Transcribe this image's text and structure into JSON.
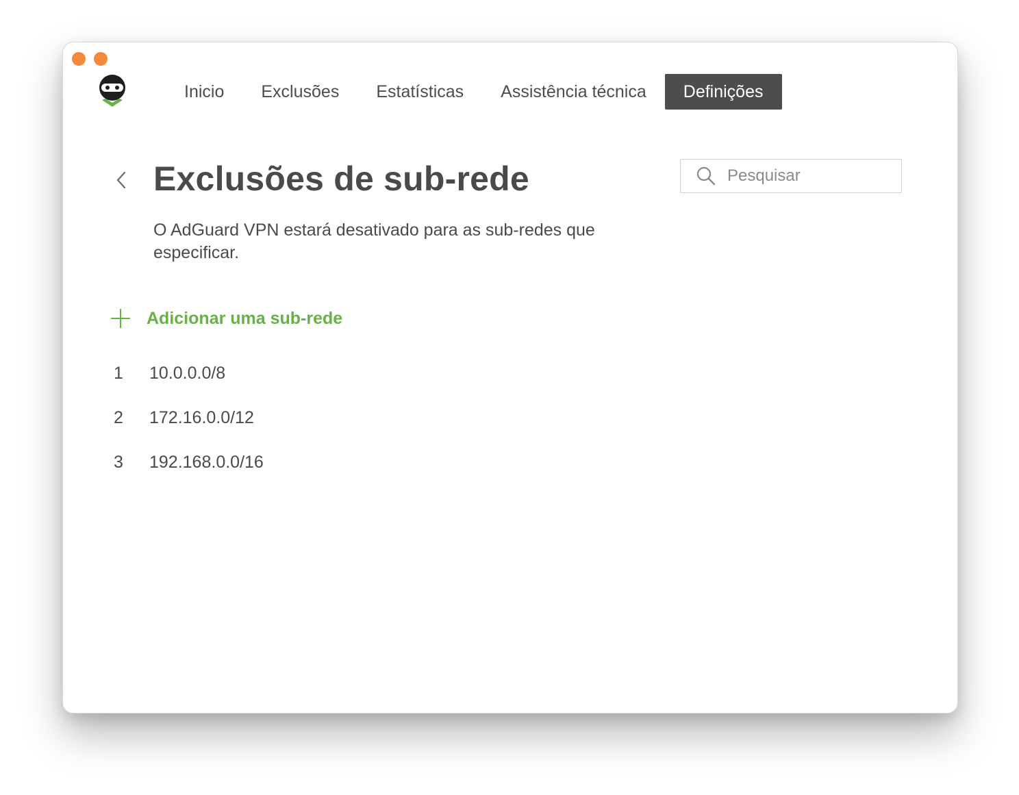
{
  "window": {
    "traffic_lights": [
      "close",
      "minimize"
    ],
    "traffic_color": "#f5893a"
  },
  "logo": {
    "icon": "adguard-ninja-icon",
    "accent": "#67b246"
  },
  "nav": {
    "items": [
      {
        "label": "Inicio"
      },
      {
        "label": "Exclusões"
      },
      {
        "label": "Estatísticas"
      },
      {
        "label": "Assistência técnica"
      },
      {
        "label": "Definições",
        "active": true
      }
    ]
  },
  "page": {
    "title": "Exclusões de sub-rede",
    "description": "O AdGuard VPN estará desativado para as sub-redes que especificar."
  },
  "search": {
    "placeholder": "Pesquisar",
    "value": ""
  },
  "add_subnet": {
    "label": "Adicionar uma sub-rede",
    "color": "#67b246"
  },
  "subnets": [
    {
      "index": "1",
      "value": "10.0.0.0/8"
    },
    {
      "index": "2",
      "value": "172.16.0.0/12"
    },
    {
      "index": "3",
      "value": "192.168.0.0/16"
    }
  ]
}
